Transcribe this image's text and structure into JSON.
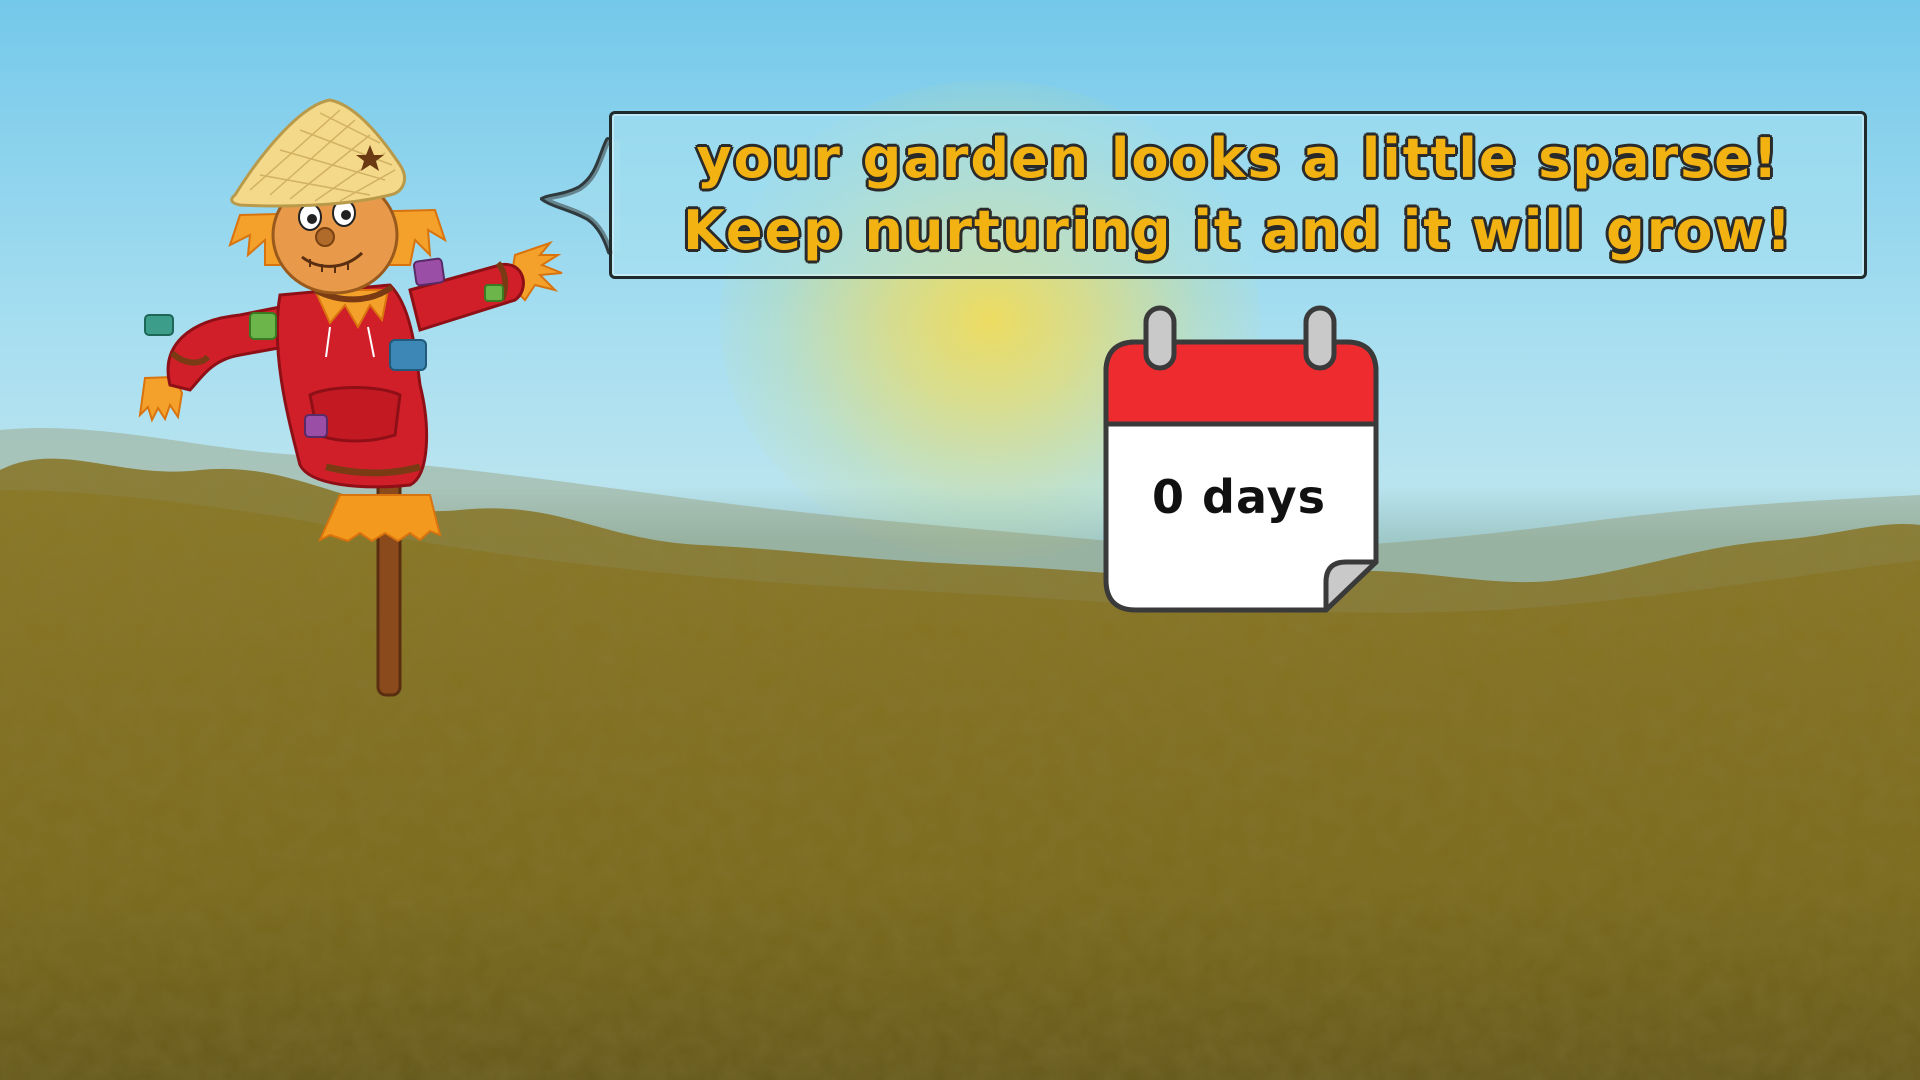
{
  "speech_bubble": {
    "line1": "your garden looks a little sparse!",
    "line2": "Keep nurturing it and it will grow!"
  },
  "day_counter": {
    "label": "0 days"
  },
  "characters": {
    "scarecrow": "scarecrow"
  },
  "icons": {
    "calendar": "calendar-icon"
  },
  "colors": {
    "sky": "#74c8ea",
    "ground": "#7a6a1c",
    "text_fill": "#f2b312",
    "calendar_header": "#ee2b2f"
  }
}
